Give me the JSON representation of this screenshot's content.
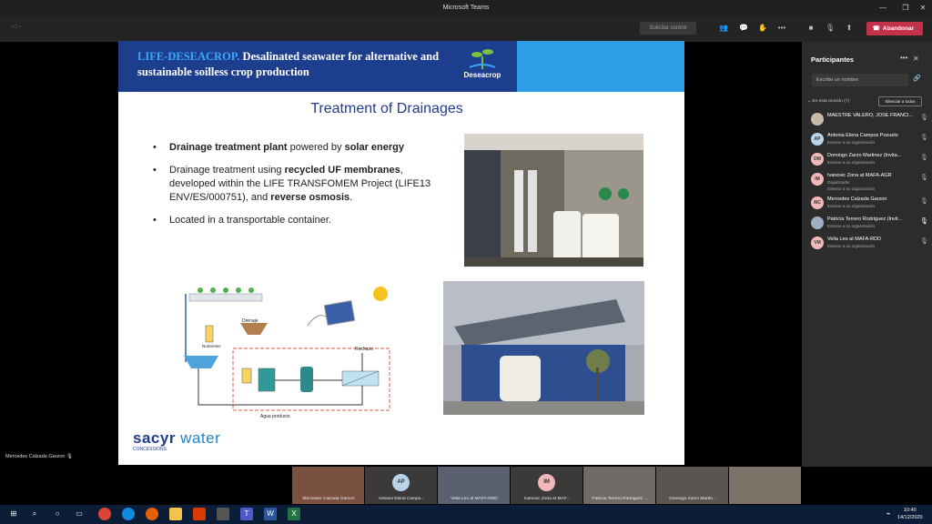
{
  "window": {
    "title": "Microsoft Teams"
  },
  "toolbar": {
    "share_request": "Solicitar control",
    "leave_label": "Abandonar",
    "more": "•••",
    "time_dots": "··:··"
  },
  "slide": {
    "banner_project": "LIFE-DESEACROP.",
    "banner_text": " Desalinated seawater for alternative and sustainable soilless crop production",
    "logo_name": "Deseacrop",
    "heading": "Treatment of Drainages",
    "bullets": [
      {
        "b1": "Drainage treatment plant",
        "t1": " powered by ",
        "b2": "solar energy",
        "t2": ""
      },
      {
        "b1": "",
        "t1": "Drainage treatment using ",
        "b2": "recycled UF membranes",
        "t2": ", developed within the LIFE TRANSFOMEM Project (LIFE13 ENV/ES/000751), and "
      },
      {
        "b1": "",
        "t1": "Located in a transportable container.",
        "b2": "",
        "t2": ""
      }
    ],
    "bullet2_tail": "reverse osmosis",
    "diagram": {
      "drenaje": "Drenaje",
      "nutrientes": "Nutrientes",
      "rechazo": "Rechazo",
      "agua_producto": "Agua producto"
    },
    "sacyr": "sacyr",
    "sacyr_water": " water",
    "sacyr_sub": "CONCESSIONS"
  },
  "presenter": {
    "name": "Mercedes Calzada Garzon"
  },
  "panel": {
    "title": "Participantes",
    "invite_placeholder": "Escribe un nombre",
    "meeting_label": "En esta reunión (7)",
    "mute_all": "Silenciar a todos",
    "participants": [
      {
        "initials": "",
        "name": "MAESTRE VALERO, JOSÉ FRANCI...",
        "sub": "",
        "color": "#c8b8a8"
      },
      {
        "initials": "AP",
        "name": "Antonia Elena Campos Pozuelo",
        "sub": "Externo a su organización",
        "color": "#b9d4e8"
      },
      {
        "initials": "DM",
        "name": "Domingo Zarzo Martinez (Invita...",
        "sub": "Externo a su organización",
        "color": "#f1b9b9"
      },
      {
        "initials": "IM",
        "name": "Ivanovic Zona at MAFA-AGR",
        "sub": "Organizador",
        "sub2": "Externo a su organización",
        "color": "#f1b9b9"
      },
      {
        "initials": "MC",
        "name": "Mercedes Calzada Garzon",
        "sub": "Externo a su organización",
        "color": "#f1b9b9"
      },
      {
        "initials": "",
        "name": "Patricia Terrero Rodríguez (Invit...",
        "sub": "Externo a su organización",
        "color": "#9fb0c6"
      },
      {
        "initials": "VM",
        "name": "Vella Leo at MAFA-RDD",
        "sub": "Externo a su organización",
        "color": "#f1b9b9"
      }
    ]
  },
  "videos": [
    {
      "name": "Mercedes Calzada Garzon",
      "initials": "",
      "color": "#7a5040"
    },
    {
      "name": "Antonia Elena Campo...",
      "initials": "AP",
      "color": "#b9d4e8"
    },
    {
      "name": "Vella Leo at MAFA-RDD",
      "initials": "",
      "color": "#5a6070"
    },
    {
      "name": "Ivanovic Zona at MAF...",
      "initials": "IM",
      "color": "#f1b9b9"
    },
    {
      "name": "Patricia Terrero Rodríguez ...",
      "initials": "",
      "color": "#6e6a68"
    },
    {
      "name": "Domingo Zarzo Martin...",
      "initials": "",
      "color": "#5a5550"
    },
    {
      "name": "",
      "initials": "",
      "color": "#7d7268"
    }
  ],
  "clock": {
    "time": "10:40",
    "date": "14/12/2020"
  }
}
